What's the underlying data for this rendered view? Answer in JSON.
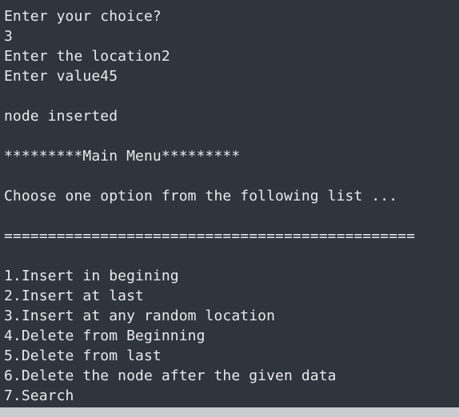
{
  "terminal": {
    "lines": [
      "Enter your choice?",
      "3",
      "Enter the location2",
      "Enter value45",
      "",
      "node inserted",
      "",
      "*********Main Menu*********",
      "",
      "Choose one option from the following list ...",
      "",
      "===============================================",
      "",
      "1.Insert in begining",
      "2.Insert at last",
      "3.Insert at any random location",
      "4.Delete from Beginning",
      "5.Delete from last",
      "6.Delete the node after the given data",
      "7.Search"
    ]
  },
  "colors": {
    "background": "#2f353d",
    "text": "#e8eaed",
    "bottom_bar": "#c9cbcf"
  }
}
